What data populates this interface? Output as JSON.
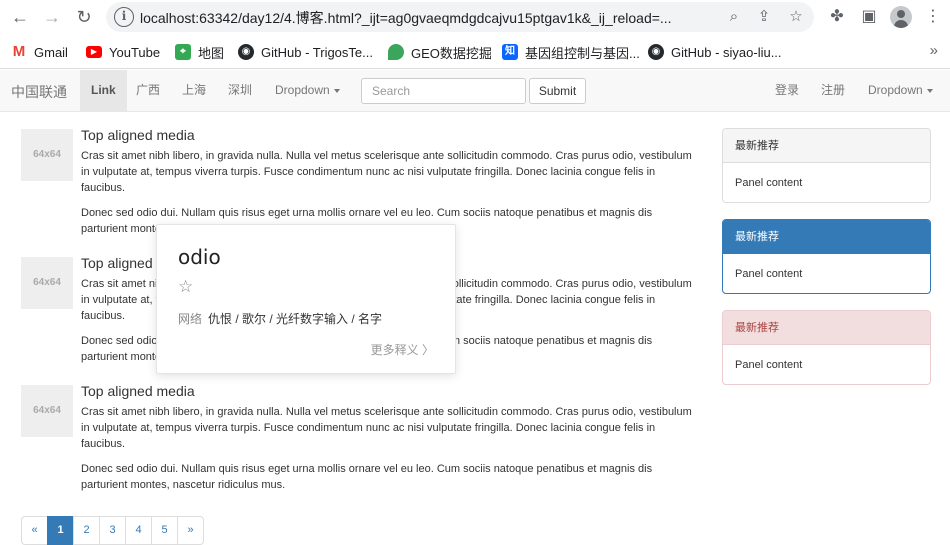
{
  "browser": {
    "url": "localhost:63342/day12/4.博客.html?_ijt=ag0gvaeqmdgdcajvu15ptgav1k&_ij_reload=...",
    "bookmarks": [
      {
        "label": "Gmail",
        "icon": "gmail-icon",
        "color": "#ea4335"
      },
      {
        "label": "YouTube",
        "icon": "youtube-icon",
        "color": "#ff0000"
      },
      {
        "label": "地图",
        "icon": "maps-icon",
        "color": "#34a853"
      },
      {
        "label": "GitHub - TrigosTe...",
        "icon": "github-icon",
        "color": "#24292e"
      },
      {
        "label": "GEO数据挖掘",
        "icon": "geo-icon",
        "color": "#3ba55c"
      },
      {
        "label": "基因组控制与基因...",
        "icon": "zhihu-icon",
        "color": "#0a66ff"
      },
      {
        "label": "GitHub - siyao-liu...",
        "icon": "github-icon",
        "color": "#24292e"
      }
    ]
  },
  "navbar": {
    "brand": "中国联通",
    "links": [
      "Link",
      "广西",
      "上海",
      "深圳"
    ],
    "dropdown_left": "Dropdown",
    "search_placeholder": "Search",
    "submit": "Submit",
    "right_links": [
      "登录",
      "注册"
    ],
    "dropdown_right": "Dropdown"
  },
  "media": [
    {
      "thumb": "64x64",
      "heading": "Top aligned media",
      "p1": "Cras sit amet nibh libero, in gravida nulla. Nulla vel metus scelerisque ante sollicitudin commodo. Cras purus odio, vestibulum in vulputate at, tempus viverra turpis. Fusce condimentum nunc ac nisi vulputate fringilla. Donec lacinia congue felis in faucibus.",
      "p2": "Donec sed odio dui. Nullam quis risus eget urna mollis ornare vel eu leo. Cum sociis natoque penatibus et magnis dis parturient montes, nascetur ridiculus mus."
    },
    {
      "thumb": "64x64",
      "heading": "Top aligned media",
      "p1": "Cras sit amet nibh libero, in gravida nulla. Nulla vel metus scelerisque ante sollicitudin commodo. Cras purus odio, vestibulum in vulputate at, tempus viverra turpis. Fusce condimentum nunc ac nisi vulputate fringilla. Donec lacinia congue felis in faucibus.",
      "p2": "Donec sed odio dui. Nullam quis risus eget urna mollis ornare vel eu leo. Cum sociis natoque penatibus et magnis dis parturient montes, nascetur ridiculus mus."
    },
    {
      "thumb": "64x64",
      "heading": "Top aligned media",
      "p1": "Cras sit amet nibh libero, in gravida nulla. Nulla vel metus scelerisque ante sollicitudin commodo. Cras purus odio, vestibulum in vulputate at, tempus viverra turpis. Fusce condimentum nunc ac nisi vulputate fringilla. Donec lacinia congue felis in faucibus.",
      "p2": "Donec sed odio dui. Nullam quis risus eget urna mollis ornare vel eu leo. Cum sociis natoque penatibus et magnis dis parturient montes, nascetur ridiculus mus."
    }
  ],
  "panels": [
    {
      "heading": "最新推荐",
      "body": "Panel content",
      "style": "default"
    },
    {
      "heading": "最新推荐",
      "body": "Panel content",
      "style": "primary"
    },
    {
      "heading": "最新推荐",
      "body": "Panel content",
      "style": "danger"
    }
  ],
  "pagination": [
    "«",
    "1",
    "2",
    "3",
    "4",
    "5",
    "»"
  ],
  "pagination_active": "1",
  "dictionary_popup": {
    "word": "odio",
    "source_tag": "网络",
    "definitions": "仇恨 / 歌尔 / 光纤数字输入 / 名字",
    "more": "更多释义 〉"
  }
}
